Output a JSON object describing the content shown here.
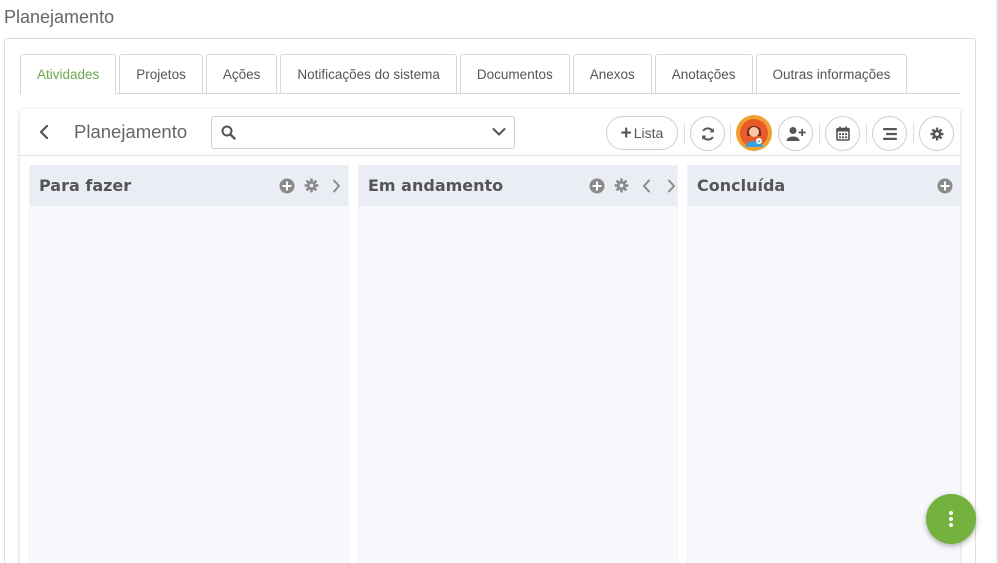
{
  "page": {
    "title": "Planejamento"
  },
  "tabs": [
    {
      "label": "Atividades",
      "active": true
    },
    {
      "label": "Projetos"
    },
    {
      "label": "Ações"
    },
    {
      "label": "Notificações do sistema"
    },
    {
      "label": "Documentos"
    },
    {
      "label": "Anexos"
    },
    {
      "label": "Anotações"
    },
    {
      "label": "Outras informações"
    }
  ],
  "board": {
    "title": "Planejamento",
    "search": {
      "value": "",
      "placeholder": ""
    },
    "add_list_label": "Lista",
    "toolbar_icons": [
      "back-icon",
      "search-icon",
      "chevron-down-icon",
      "plus-icon",
      "refresh-icon",
      "avatar",
      "add-user-icon",
      "calendar-icon",
      "align-lines-icon",
      "gear-icon"
    ],
    "columns": [
      {
        "title": "Para fazer",
        "icons": [
          "plus-circle-icon",
          "gear-icon",
          "chevron-right-icon"
        ]
      },
      {
        "title": "Em andamento",
        "icons": [
          "plus-circle-icon",
          "gear-icon",
          "chevron-left-icon",
          "chevron-right-icon"
        ]
      },
      {
        "title": "Concluída",
        "icons": [
          "plus-circle-icon"
        ]
      }
    ]
  },
  "colors": {
    "accent": "#6aa84f",
    "fab": "#74b13f",
    "column_header": "#eaeef4",
    "column_body": "#f7f9fc",
    "avatar_bg": "#f0a030"
  },
  "fab": {
    "icon": "more-vertical-icon"
  }
}
